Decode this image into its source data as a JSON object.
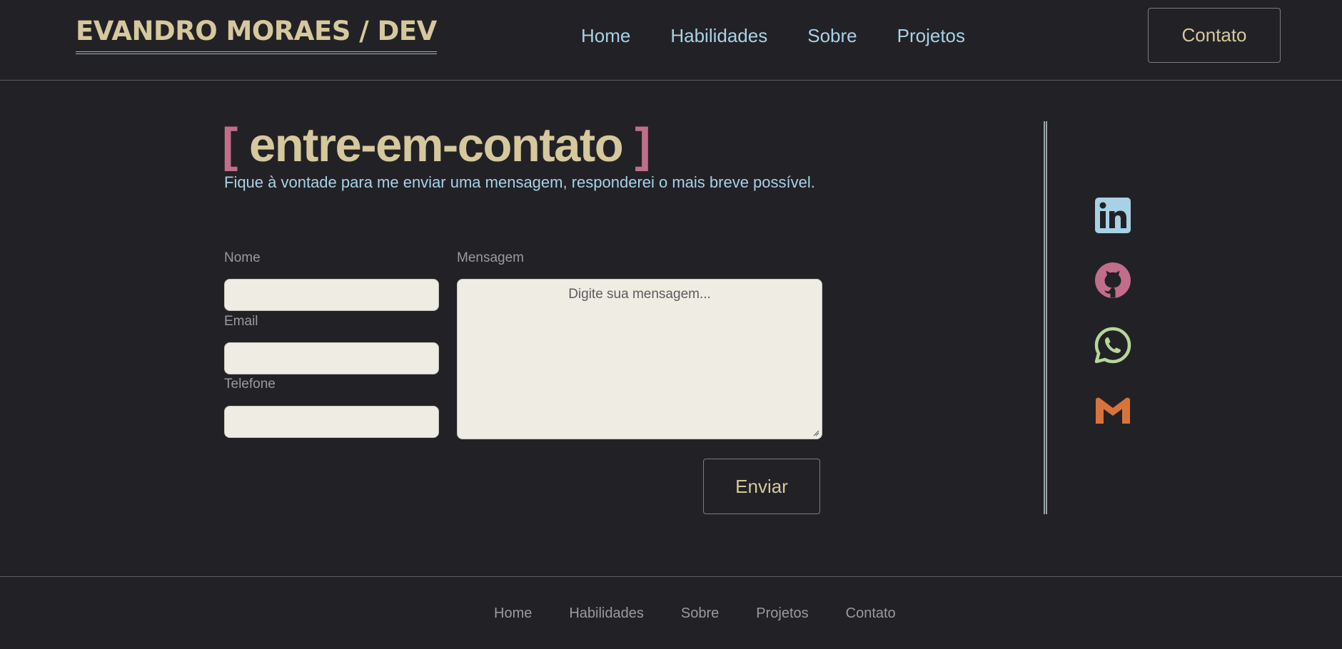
{
  "header": {
    "logo": "EVANDRO MORAES / DEV",
    "nav": [
      "Home",
      "Habilidades",
      "Sobre",
      "Projetos"
    ],
    "contact_label": "Contato"
  },
  "heading": {
    "open_bracket": "[",
    "title": "entre-em-contato",
    "close_bracket": "]",
    "subtitle": "Fique à vontade para me enviar uma mensagem, responderei o mais breve possível."
  },
  "form": {
    "name_label": "Nome",
    "name_value": "",
    "email_label": "Email",
    "email_value": "",
    "phone_label": "Telefone",
    "phone_value": "",
    "message_label": "Mensagem",
    "message_placeholder": "Digite sua mensagem...",
    "send_label": "Enviar"
  },
  "social": [
    {
      "icon": "linkedin-icon",
      "color": "#a8d1e6"
    },
    {
      "icon": "github-icon",
      "color": "#c06e89"
    },
    {
      "icon": "whatsapp-icon",
      "color": "#b7d79a"
    },
    {
      "icon": "gmail-icon",
      "color": "#d8733e"
    }
  ],
  "footer": {
    "nav": [
      "Home",
      "Habilidades",
      "Sobre",
      "Projetos",
      "Contato"
    ]
  },
  "colors": {
    "background": "#222226",
    "accent_gold": "#d6c89d",
    "accent_blue": "#a8d1e6",
    "accent_pink": "#c06e89",
    "input_bg": "#efece3"
  }
}
